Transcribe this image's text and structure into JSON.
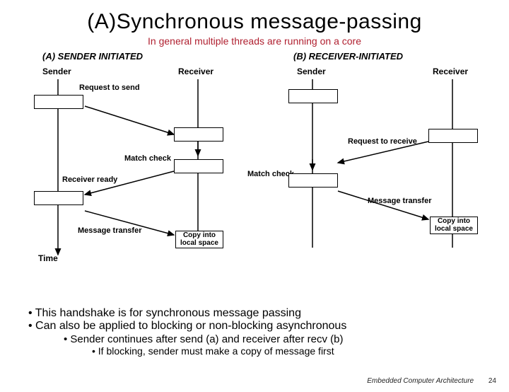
{
  "title": "(A)Synchronous message-passing",
  "subtitle": "In general multiple threads are running on a core",
  "diagram": {
    "sectionA": "(A) SENDER INITIATED",
    "sectionB": "(B) RECEIVER-INITIATED",
    "sender": "Sender",
    "receiver": "Receiver",
    "requestToSend": "Request to send",
    "matchCheck": "Match check",
    "receiverReady": "Receiver ready",
    "messageTransfer": "Message transfer",
    "requestToReceive": "Request to receive",
    "copyInto": "Copy into local space",
    "time": "Time"
  },
  "bullets": {
    "b1": "This handshake is for synchronous message passing",
    "b2": "Can also be applied to blocking or non-blocking asynchronous",
    "b2a": "Sender continues after send (a) and receiver after recv (b)",
    "b2b": "If blocking, sender must make a copy of message first"
  },
  "footer": {
    "text": "Embedded Computer Architecture",
    "page": "24"
  }
}
